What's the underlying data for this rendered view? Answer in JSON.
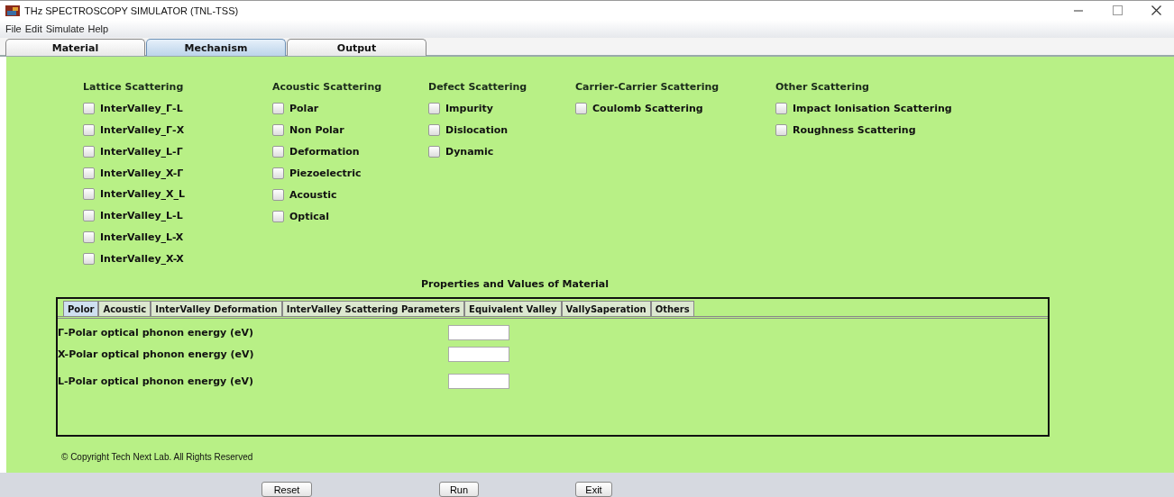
{
  "window": {
    "title": "THz SPECTROSCOPY SIMULATOR (TNL-TSS)"
  },
  "menu": [
    "File",
    "Edit",
    "Simulate",
    "Help"
  ],
  "tabs": [
    {
      "label": "Material",
      "selected": false
    },
    {
      "label": "Mechanism",
      "selected": true
    },
    {
      "label": "Output",
      "selected": false
    }
  ],
  "groups": [
    {
      "title": "Lattice Scattering",
      "options": [
        {
          "label": "InterValley_Γ-L",
          "checked": false
        },
        {
          "label": "InterValley_Γ-X",
          "checked": false
        },
        {
          "label": "InterValley_L-Γ",
          "checked": false
        },
        {
          "label": "InterValley_X-Γ",
          "checked": false
        },
        {
          "label": "InterValley_X_L",
          "checked": false
        },
        {
          "label": "InterValley_L-L",
          "checked": false
        },
        {
          "label": "InterValley_L-X",
          "checked": false
        },
        {
          "label": "InterValley_X-X",
          "checked": false
        }
      ]
    },
    {
      "title": "Acoustic Scattering",
      "options": [
        {
          "label": "Polar",
          "checked": false
        },
        {
          "label": "Non Polar",
          "checked": false
        },
        {
          "label": "Deformation",
          "checked": false
        },
        {
          "label": "Piezoelectric",
          "checked": false
        },
        {
          "label": "Acoustic",
          "checked": false
        },
        {
          "label": "Optical",
          "checked": false
        }
      ]
    },
    {
      "title": "Defect Scattering",
      "options": [
        {
          "label": "Impurity",
          "checked": false
        },
        {
          "label": "Dislocation",
          "checked": false
        },
        {
          "label": "Dynamic",
          "checked": false
        }
      ]
    },
    {
      "title": "Carrier-Carrier Scattering",
      "options": [
        {
          "label": "Coulomb Scattering",
          "checked": false
        }
      ]
    },
    {
      "title": "Other Scattering",
      "options": [
        {
          "label": "Impact Ionisation Scattering",
          "checked": false
        },
        {
          "label": "Roughness Scattering",
          "checked": false
        }
      ]
    }
  ],
  "properties": {
    "title": "Properties and Values of Material",
    "tabs": [
      {
        "label": "Polor",
        "selected": true
      },
      {
        "label": "Acoustic",
        "selected": false
      },
      {
        "label": "InterValley Deformation",
        "selected": false
      },
      {
        "label": "InterValley Scattering Parameters",
        "selected": false
      },
      {
        "label": "Equivalent Valley",
        "selected": false
      },
      {
        "label": "VallySaperation",
        "selected": false
      },
      {
        "label": "Others",
        "selected": false
      }
    ],
    "fields": [
      {
        "label": "Γ-Polar optical phonon energy (eV)"
      },
      {
        "label": "X-Polar optical phonon energy (eV)"
      },
      {
        "label": "L-Polar optical phonon energy (eV)"
      }
    ]
  },
  "copyright": "© Copyright Tech Next Lab. All Rights Reserved",
  "buttons": [
    "Reset",
    "Run",
    "Exit"
  ]
}
